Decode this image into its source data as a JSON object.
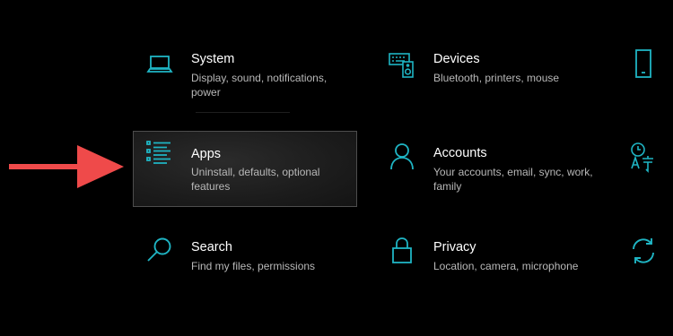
{
  "settings": {
    "tiles": [
      {
        "id": "system",
        "title": "System",
        "description": "Display, sound, notifications, power",
        "icon": "laptop-icon"
      },
      {
        "id": "devices",
        "title": "Devices",
        "description": "Bluetooth, printers, mouse",
        "icon": "keyboard-speaker-icon"
      },
      {
        "id": "apps",
        "title": "Apps",
        "description": "Uninstall, defaults, optional features",
        "icon": "apps-list-icon"
      },
      {
        "id": "accounts",
        "title": "Accounts",
        "description": "Your accounts, email, sync, work, family",
        "icon": "person-icon"
      },
      {
        "id": "search",
        "title": "Search",
        "description": "Find my files, permissions",
        "icon": "search-icon"
      },
      {
        "id": "privacy",
        "title": "Privacy",
        "description": "Location, camera, microphone",
        "icon": "lock-icon"
      }
    ],
    "edge_icons": [
      "phone-icon",
      "time-language-icon",
      "update-sync-icon"
    ]
  },
  "colors": {
    "background": "#000000",
    "accent": "#1fb5c4",
    "hover_border": "#4d4d4d",
    "annotation_arrow": "#ef4a4a",
    "description_text": "#b8b8b8"
  }
}
